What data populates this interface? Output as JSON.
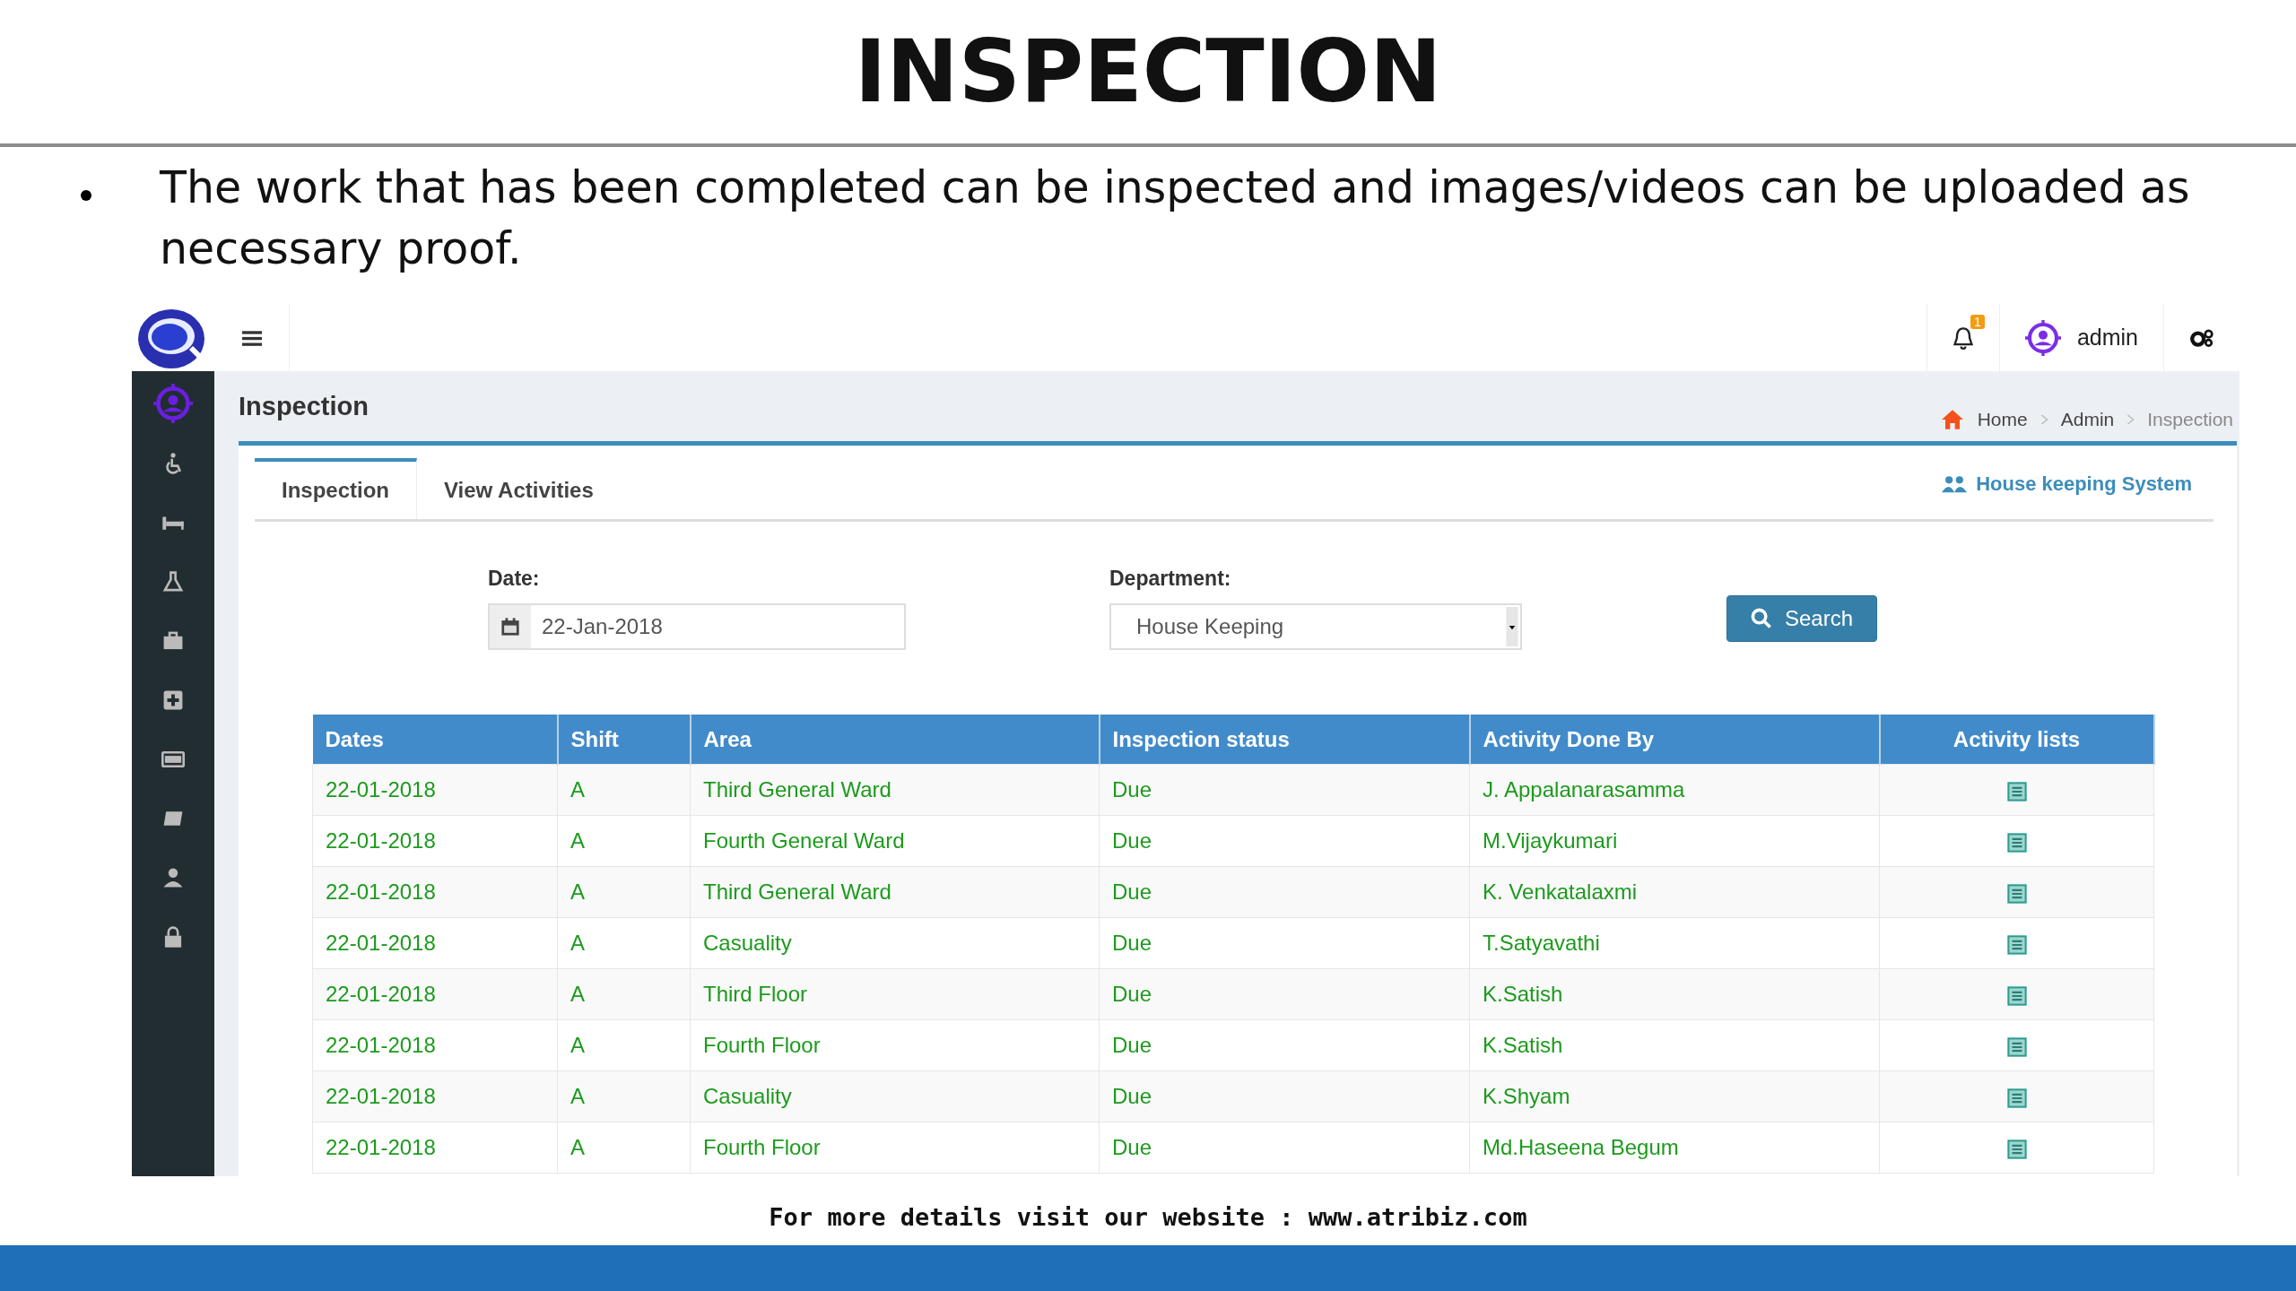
{
  "slide": {
    "title": "INSPECTION",
    "bullets": [
      "The work that has been completed can be inspected and images/videos can be uploaded as necessary proof."
    ],
    "footer": "For more details visit our website : www.atribiz.com"
  },
  "app": {
    "topbar": {
      "notification_count": "1",
      "user": "admin"
    },
    "page_title": "Inspection",
    "breadcrumbs": [
      {
        "label": "Home",
        "current": false
      },
      {
        "label": "Admin",
        "current": false
      },
      {
        "label": "Inspection",
        "current": true
      }
    ],
    "tabs": [
      {
        "label": "Inspection",
        "selected": true
      },
      {
        "label": "View Activities",
        "selected": false
      }
    ],
    "system_link": "House keeping System",
    "form": {
      "date": {
        "label": "Date:",
        "value": "22-Jan-2018"
      },
      "department": {
        "label": "Department:",
        "value": "House Keeping"
      },
      "search_button": "Search"
    },
    "table": {
      "columns": [
        "Dates",
        "Shift",
        "Area",
        "Inspection status",
        "Activity Done By",
        "Activity lists"
      ],
      "rows": [
        {
          "date": "22-01-2018",
          "shift": "A",
          "area": "Third General Ward",
          "status": "Due",
          "done_by": "J. Appalanarasamma"
        },
        {
          "date": "22-01-2018",
          "shift": "A",
          "area": "Fourth General Ward",
          "status": "Due",
          "done_by": "M.Vijaykumari"
        },
        {
          "date": "22-01-2018",
          "shift": "A",
          "area": "Third General Ward",
          "status": "Due",
          "done_by": "K. Venkatalaxmi"
        },
        {
          "date": "22-01-2018",
          "shift": "A",
          "area": "Casuality",
          "status": "Due",
          "done_by": "T.Satyavathi"
        },
        {
          "date": "22-01-2018",
          "shift": "A",
          "area": "Third Floor",
          "status": "Due",
          "done_by": "K.Satish"
        },
        {
          "date": "22-01-2018",
          "shift": "A",
          "area": "Fourth Floor",
          "status": "Due",
          "done_by": "K.Satish"
        },
        {
          "date": "22-01-2018",
          "shift": "A",
          "area": "Casuality",
          "status": "Due",
          "done_by": "K.Shyam"
        },
        {
          "date": "22-01-2018",
          "shift": "A",
          "area": "Fourth Floor",
          "status": "Due",
          "done_by": "Md.Haseena Begum"
        }
      ]
    }
  }
}
